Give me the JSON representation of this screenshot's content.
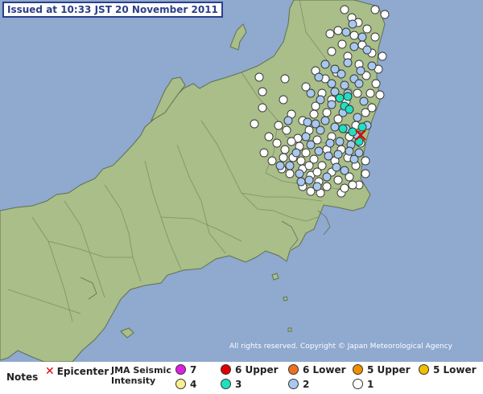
{
  "header": {
    "issued": "Issued at 10:33 JST  20 November 2011"
  },
  "copyright": "All rights reserved. Copyright © Japan Meteorological Agency",
  "legend": {
    "notes": "Notes",
    "epicenter": "Epicenter",
    "intensity_label_line1": "JMA Seismic",
    "intensity_label_line2": "Intensity",
    "items": [
      {
        "label": "7",
        "color": "#e020e0"
      },
      {
        "label": "6 Upper",
        "color": "#e00000"
      },
      {
        "label": "6 Lower",
        "color": "#f07020"
      },
      {
        "label": "5 Upper",
        "color": "#f09000"
      },
      {
        "label": "5 Lower",
        "color": "#f0c000"
      },
      {
        "label": "4",
        "color": "#f8f090"
      },
      {
        "label": "3",
        "color": "#20e0c0"
      },
      {
        "label": "2",
        "color": "#a8c8f0"
      },
      {
        "label": "1",
        "color": "#ffffff"
      }
    ]
  },
  "colors": {
    "sea": "#8fa9cf",
    "land": "#a9be88",
    "border": "#5f7050",
    "epicenter": "#e00000"
  },
  "epicenter_icon": "red-x-icon"
}
